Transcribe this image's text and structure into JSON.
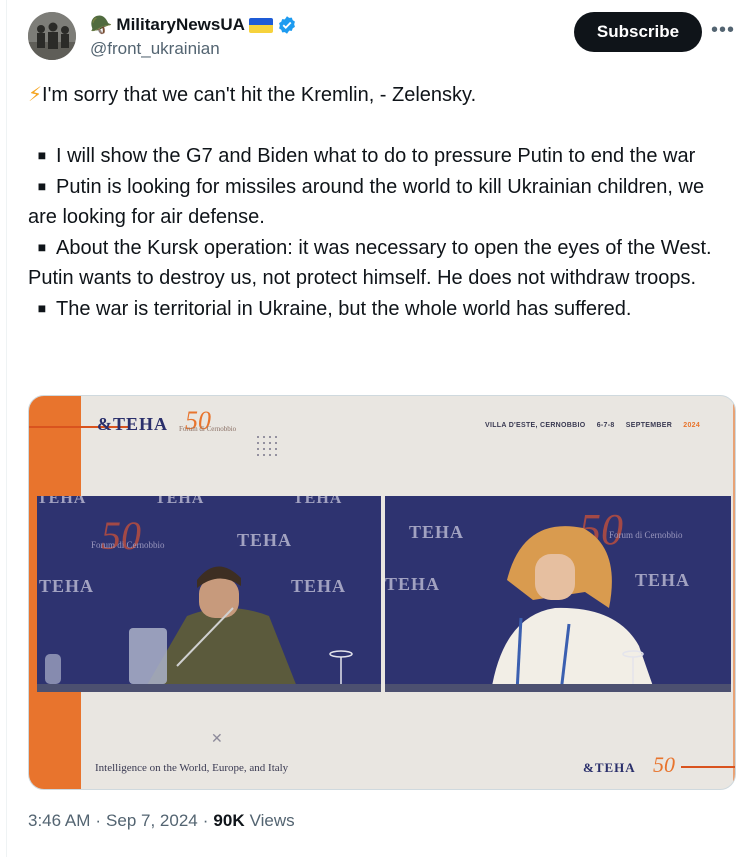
{
  "author": {
    "display_name": "MilitaryNewsUA",
    "handle": "@front_ukrainian",
    "name_emoji": "helmet-emoji",
    "flag": "ukraine-flag",
    "verified": true
  },
  "actions": {
    "subscribe_label": "Subscribe",
    "more_label": "•••"
  },
  "tweet": {
    "headline": "I'm sorry that we can't hit the Kremlin, - Zelensky.",
    "bullets": [
      "I will show the G7 and Biden what to do to pressure Putin to end the war",
      "Putin is looking for missiles around the world to kill Ukrainian children, we are looking for air defense.",
      "About the Kursk operation: it was necessary to open the eyes of the West. Putin wants to destroy us, not protect himself. He does not withdraw troops.",
      "The war is territorial in Ukraine, but the whole world has suffered."
    ]
  },
  "media": {
    "brand": "TEHA",
    "anniversary": "50",
    "forum_name": "Forum di Cernobbio",
    "venue": "VILLA D'ESTE, CERNOBBIO",
    "dates": "6-7-8",
    "month": "SEPTEMBER",
    "year": "2024",
    "tagline": "Intelligence on the World, Europe, and Italy"
  },
  "meta": {
    "time": "3:46 AM",
    "separator": "·",
    "date": "Sep 7, 2024",
    "views_count": "90K",
    "views_label": "Views"
  },
  "colors": {
    "accent_orange": "#e8742d",
    "brand_navy": "#2a2f6b",
    "verified_blue": "#1d9bf0",
    "text": "#0f1419",
    "muted": "#536471"
  }
}
